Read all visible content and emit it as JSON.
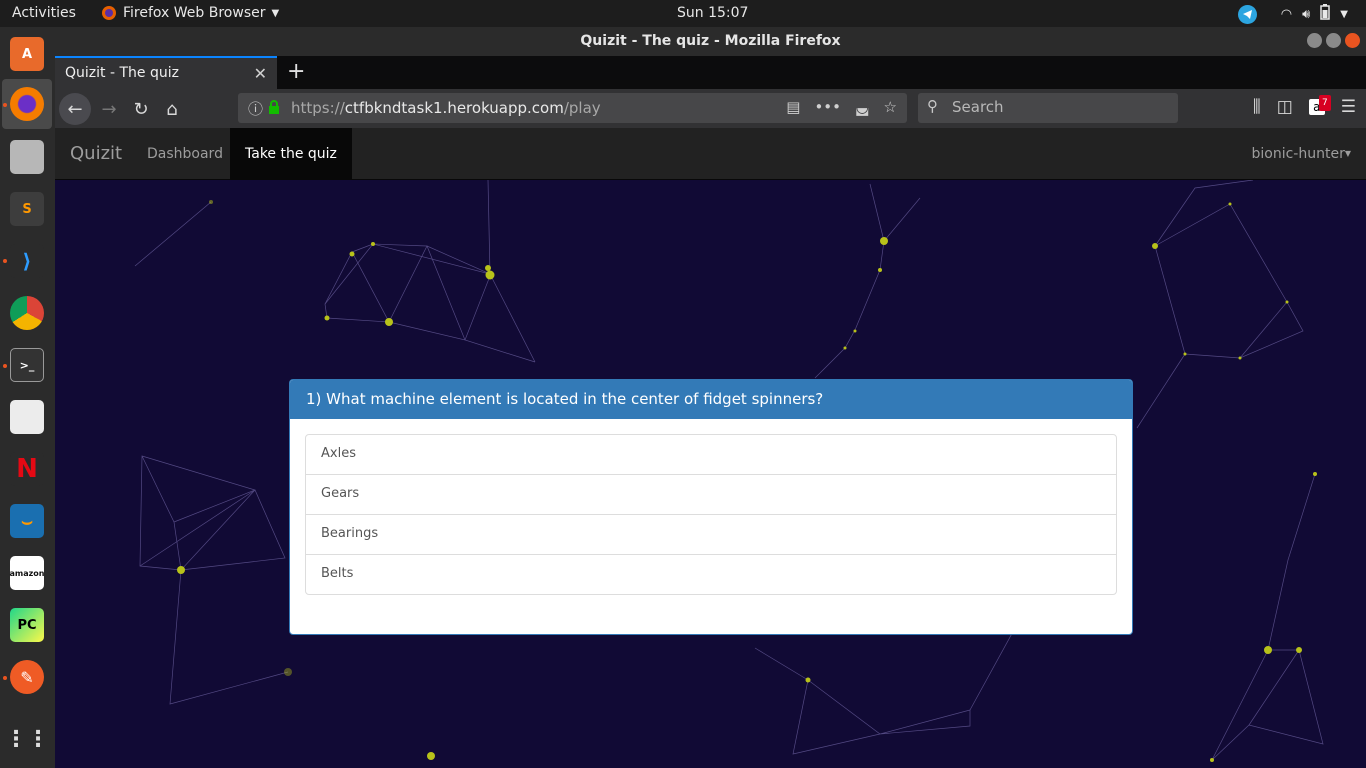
{
  "topbar": {
    "activities": "Activities",
    "app_name": "Firefox Web Browser",
    "clock": "Sun 15:07"
  },
  "window": {
    "title": "Quizit - The quiz - Mozilla Firefox"
  },
  "browser": {
    "tab_title": "Quizit - The quiz",
    "url_prefix": "https://",
    "url_host": "ctfbkndtask1.herokuapp.com",
    "url_path": "/play",
    "search_placeholder": "Search",
    "amazon_badge": "7"
  },
  "app": {
    "brand": "Quizit",
    "nav": [
      "Dashboard",
      "Take the quiz"
    ],
    "user": "bionic-hunter"
  },
  "quiz": {
    "question": "1) What machine element is located in the center of fidget spinners?",
    "options": [
      "Axles",
      "Gears",
      "Bearings",
      "Belts"
    ]
  },
  "colors": {
    "accent": "#337ab7",
    "page_bg": "#110a35",
    "node": "#b8c21a"
  }
}
